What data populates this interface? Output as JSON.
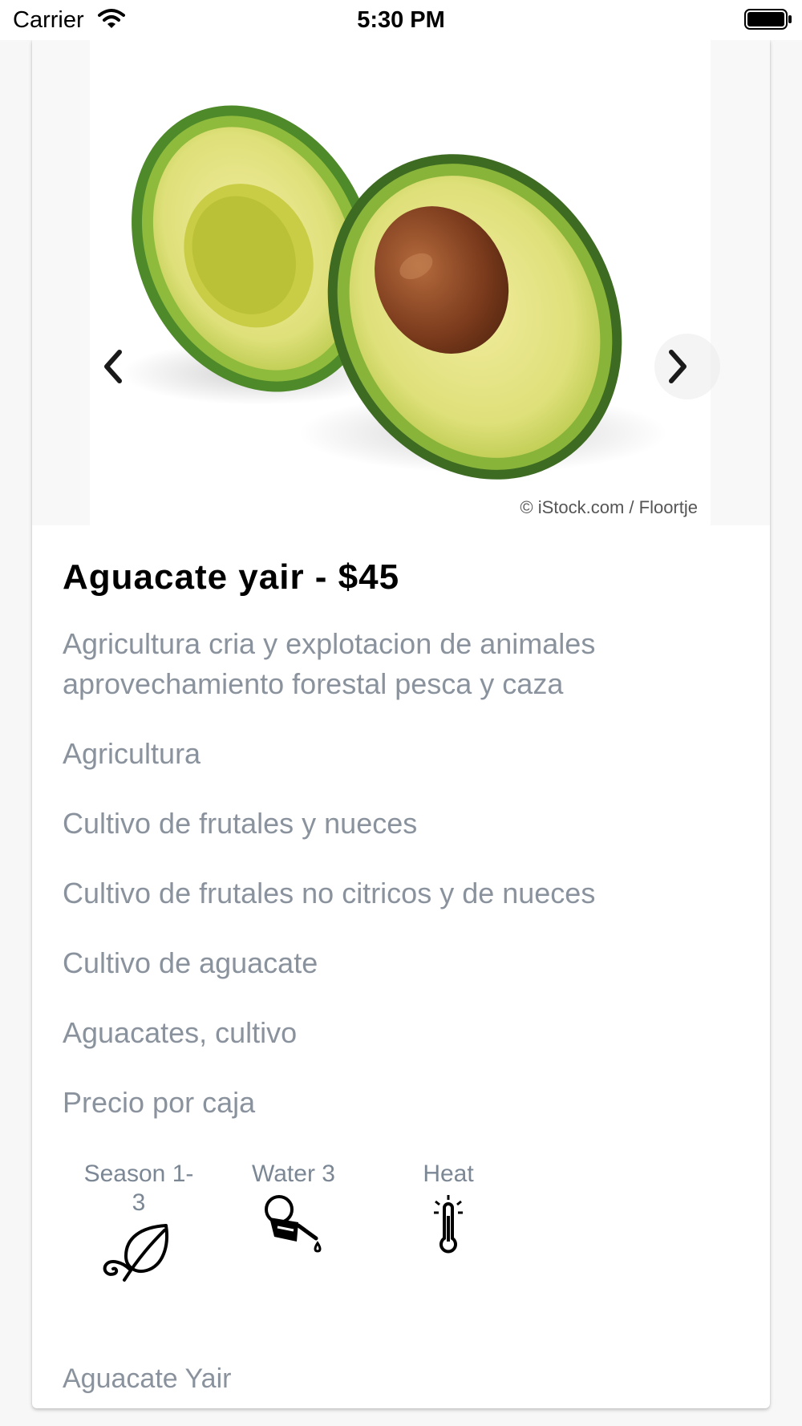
{
  "status_bar": {
    "carrier": "Carrier",
    "time": "5:30 PM"
  },
  "carousel": {
    "image_credit": "© iStock.com / Floortje",
    "prev_icon": "chevron-left-icon",
    "next_icon": "chevron-right-icon"
  },
  "product": {
    "title": "Aguacate yair - $45",
    "description": "Agricultura cria y explotacion de animales aprovechamiento forestal pesca y caza",
    "categories": [
      "Agricultura",
      "Cultivo de frutales y nueces",
      "Cultivo de frutales no citricos y de nueces",
      "Cultivo de aguacate",
      "Aguacates, cultivo",
      "Precio por caja"
    ]
  },
  "attributes": [
    {
      "label": "Season 1-3",
      "icon": "leaf-icon"
    },
    {
      "label": "Water 3",
      "icon": "watering-can-icon"
    },
    {
      "label": "Heat",
      "icon": "thermometer-icon"
    }
  ],
  "footer": {
    "label": "Aguacate Yair"
  },
  "colors": {
    "text_primary": "#000000",
    "text_secondary": "#8a939d",
    "card_background": "#ffffff",
    "page_background": "#f7f7f7"
  }
}
